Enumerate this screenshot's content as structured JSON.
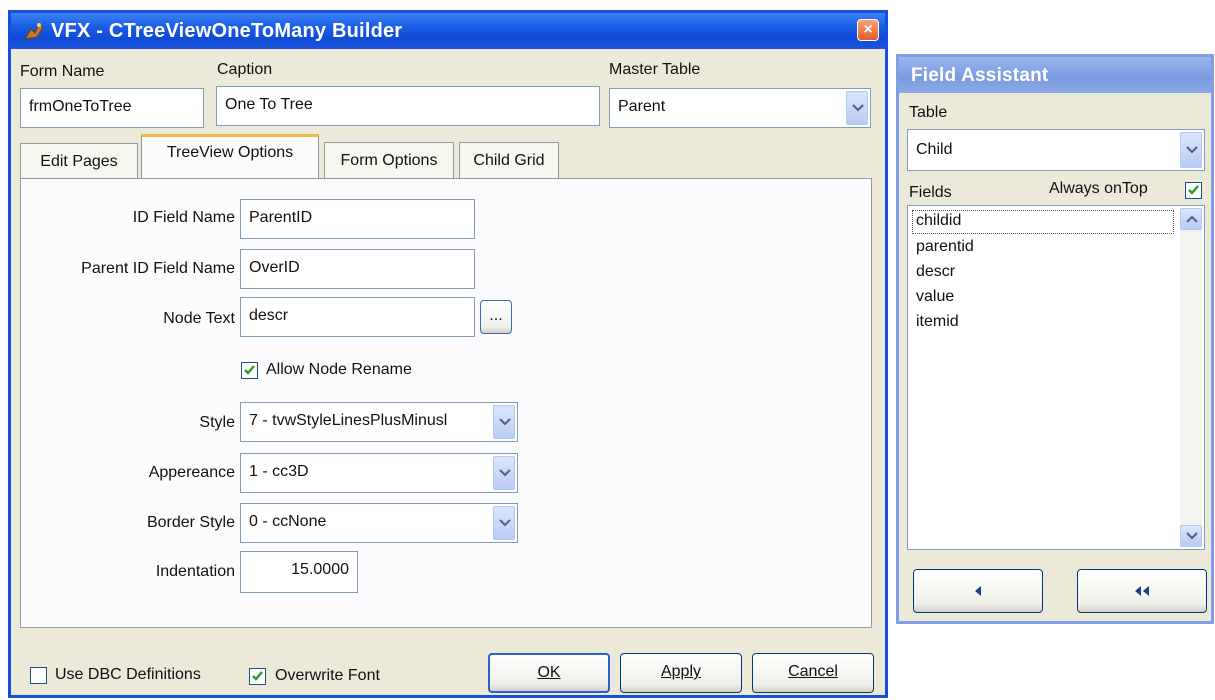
{
  "main_window": {
    "title": "VFX - CTreeViewOneToMany Builder",
    "labels": {
      "form_name": "Form Name",
      "caption": "Caption",
      "master_table": "Master Table"
    },
    "fields": {
      "form_name": "frmOneToTree",
      "caption": "One To Tree",
      "master_table": "Parent"
    },
    "tabs": [
      {
        "label": "Edit Pages",
        "active": false
      },
      {
        "label": "TreeView Options",
        "active": true
      },
      {
        "label": "Form Options",
        "active": false
      },
      {
        "label": "Child Grid",
        "active": false
      }
    ],
    "treeview_options": {
      "id_field_label": "ID Field Name",
      "id_field_value": "ParentID",
      "parent_id_label": "Parent  ID Field Name",
      "parent_id_value": "OverID",
      "node_text_label": "Node Text",
      "node_text_value": "descr",
      "ellipsis_label": "...",
      "allow_rename_label": "Allow Node Rename",
      "allow_rename_checked": true,
      "style_label": "Style",
      "style_value": "7 - tvwStyleLinesPlusMinusl",
      "appearance_label": "Appereance",
      "appearance_value": "1 - cc3D",
      "border_style_label": "Border Style",
      "border_style_value": "0 - ccNone",
      "indentation_label": "Indentation",
      "indentation_value": "15.0000"
    },
    "footer": {
      "use_dbc_label": "Use DBC Definitions",
      "use_dbc_checked": false,
      "overwrite_font_label": "Overwrite Font",
      "overwrite_font_checked": true,
      "ok_label": "OK",
      "apply_label": "Apply",
      "cancel_label": "Cancel"
    }
  },
  "field_assistant": {
    "title": "Field Assistant",
    "table_label": "Table",
    "table_value": "Child",
    "fields_label": "Fields",
    "always_on_top_label": "Always onTop",
    "always_on_top_checked": true,
    "fields": [
      "childid",
      "parentid",
      "descr",
      "value",
      "itemid"
    ],
    "selected_field": "childid"
  },
  "colors": {
    "title_blue": "#1550d8",
    "face": "#ece9d8",
    "tab_highlight": "#f5b844",
    "check": "#21a121"
  }
}
